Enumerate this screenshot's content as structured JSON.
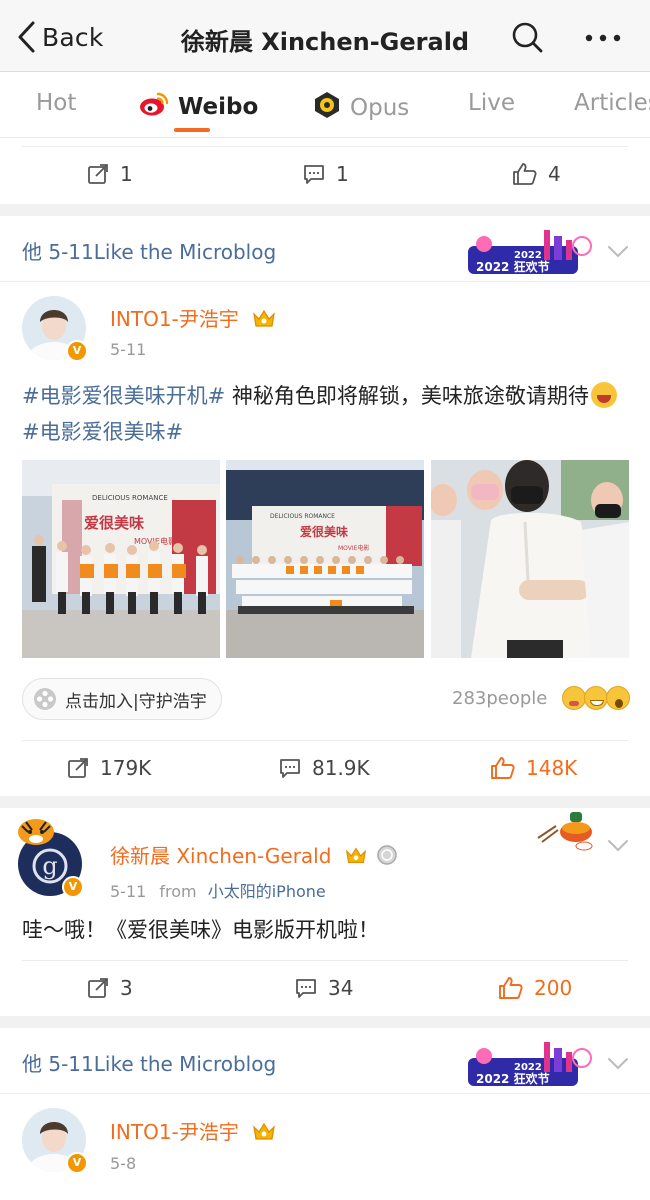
{
  "nav": {
    "back_label": "Back",
    "title": "徐新晨 Xinchen-Gerald"
  },
  "tabs": [
    {
      "label": "Hot",
      "active": false
    },
    {
      "label": "Weibo",
      "active": true,
      "icon": "weibo-logo-icon"
    },
    {
      "label": "Opus",
      "active": false,
      "icon": "opus-icon"
    },
    {
      "label": "Live",
      "active": false
    },
    {
      "label": "Articles",
      "active": false
    }
  ],
  "top_actions": {
    "repost": "1",
    "comment": "1",
    "like": "4"
  },
  "liked_bar_1": {
    "text": "他 5-11Like the Microblog",
    "promo": "2022 狂欢节"
  },
  "post1": {
    "username": "INTO1-尹浩宇",
    "time": "5-11",
    "tag1": "#电影爱很美味开机#",
    "text1": " 神秘角色即将解锁，美味旅途敬请期待",
    "tag2": "#电影爱很美味#",
    "photos": [
      {
        "caption_main": "爱很美味",
        "caption_sub": "DELICIOUS ROMANCE",
        "caption_movie": "MOVIE电影"
      },
      {
        "caption_main": "爱很美味",
        "caption_sub": "DELICIOUS ROMANCE",
        "caption_movie": "MOVIE电影"
      },
      {
        "caption_main": ""
      }
    ],
    "chip": "点击加入|守护浩宇",
    "people": "283people",
    "actions": {
      "repost": "179K",
      "comment": "81.9K",
      "like": "148K"
    }
  },
  "post2": {
    "username": "徐新晨 Xinchen-Gerald",
    "time": "5-11",
    "source_prefix": "from",
    "source": "小太阳的iPhone",
    "text": "哇～哦！《爱很美味》电影版开机啦！",
    "actions": {
      "repost": "3",
      "comment": "34",
      "like": "200"
    }
  },
  "liked_bar_2": {
    "text": "他 5-11Like the Microblog",
    "promo": "2022 狂欢节"
  },
  "post3": {
    "username": "INTO1-尹浩宇",
    "time": "5-8"
  },
  "colors": {
    "accent": "#f26c1d",
    "link": "#4a6d99",
    "vip": "#f39700"
  }
}
